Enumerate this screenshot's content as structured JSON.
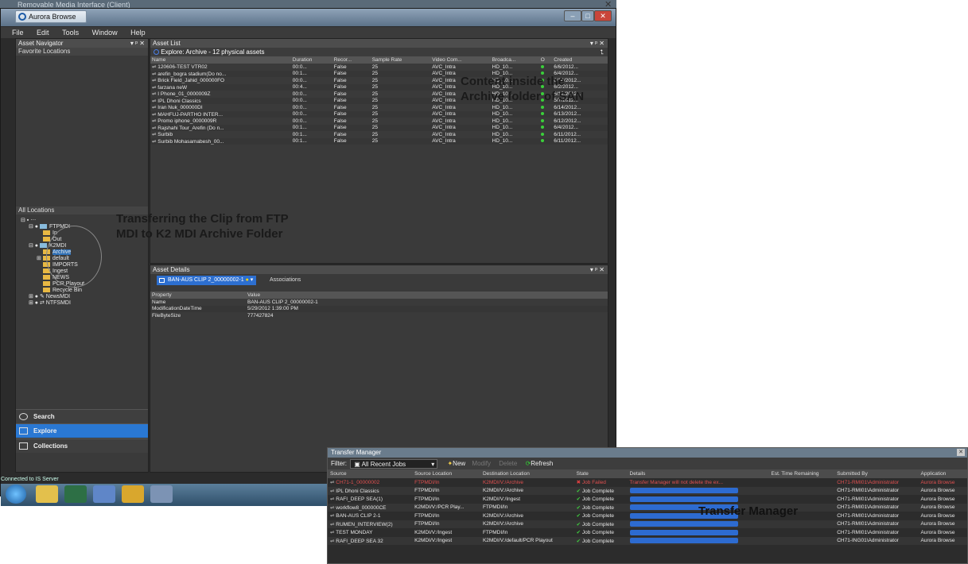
{
  "outer_title": "Removable Media Interface (Client)",
  "app_tab": "Aurora Browse",
  "menu": [
    "File",
    "Edit",
    "Tools",
    "Window",
    "Help"
  ],
  "asset_navigator": {
    "title": "Asset Navigator",
    "favorites": "Favorite Locations",
    "all_locations": "All Locations"
  },
  "tree": [
    "FTPMDI",
    "In",
    "Out",
    "K2MDI",
    "Archive",
    "default",
    "IMPORTS",
    "Ingest",
    "NEWS",
    "PCR Playout",
    "Recycle Bin",
    "NewsMDI",
    "NTFSMDI"
  ],
  "nav_buttons": {
    "search": "Search",
    "explore": "Explore",
    "collections": "Collections"
  },
  "asset_list": {
    "title": "Asset List",
    "explore_label": "Explore: Archive - 12 physical assets",
    "columns": [
      "Name",
      "Duration",
      "Recor...",
      "Sample Rate",
      "Video Com...",
      "Broadca...",
      "O",
      "Created"
    ],
    "rows": [
      [
        "120606-TEST VTR02",
        "00:0...",
        "False",
        "25",
        "AVC_Intra",
        "HD_10...",
        "6/6/2012..."
      ],
      [
        "arefin_bogra stadium(Do no...",
        "00:1...",
        "False",
        "25",
        "AVC_Intra",
        "HD_10...",
        "6/4/2012..."
      ],
      [
        "Brick Field_Jahid_000000FO",
        "00:0...",
        "False",
        "25",
        "AVC_Intra",
        "HD_10...",
        "6/14/2012..."
      ],
      [
        "farzana neW",
        "00:4...",
        "False",
        "25",
        "AVC_Intra",
        "HD_10...",
        "6/2/2012..."
      ],
      [
        "I Phone_01_0000009Z",
        "00:0...",
        "False",
        "25",
        "AVC_Intra",
        "HD_10...",
        "6/12/2012..."
      ],
      [
        "IPL Dhoni Classics",
        "00:0...",
        "False",
        "25",
        "AVC_Intra",
        "HD_10...",
        "5/7/2012..."
      ],
      [
        "Iran Nuk_000000DI",
        "00:0...",
        "False",
        "25",
        "AVC_Intra",
        "HD_10...",
        "6/14/2012..."
      ],
      [
        "MAHFUJ-PARTHO INTER...",
        "00:0...",
        "False",
        "25",
        "AVC_Intra",
        "HD_10...",
        "6/13/2012..."
      ],
      [
        "Promo iphone_0000009R",
        "00:0...",
        "False",
        "25",
        "AVC_Intra",
        "HD_10...",
        "6/12/2012..."
      ],
      [
        "Rajshahi Tour_Arefin (Do n...",
        "00:1...",
        "False",
        "25",
        "AVC_Intra",
        "HD_10...",
        "6/4/2012..."
      ],
      [
        "Surbib",
        "00:1...",
        "False",
        "25",
        "AVC_Intra",
        "HD_10...",
        "6/11/2012..."
      ],
      [
        "Surbib Mohasamabesh_00...",
        "00:1...",
        "False",
        "25",
        "AVC_Intra",
        "HD_10...",
        "6/11/2012..."
      ]
    ]
  },
  "asset_details": {
    "title": "Asset Details",
    "selected_tab": "BAN-AUS CLIP 2_00000002-1",
    "associations": "Associations",
    "columns": [
      "Property",
      "Value"
    ],
    "rows": [
      [
        "Name",
        "BAN-AUS CLIP 2_00000002-1"
      ],
      [
        "ModificationDateTime",
        "5/29/2012 1:39:00 PM"
      ],
      [
        "FileByteSize",
        "777427824"
      ]
    ]
  },
  "status": "Connected to IS Server",
  "annotations": {
    "content": "Content inside the Archive folder of  SAN",
    "transferring": "Transferring the Clip from FTP MDI to K2 MDI Archive Folder",
    "tm": "Transfer  Manager"
  },
  "transfer_manager": {
    "title": "Transfer Manager",
    "filter_label": "Filter:",
    "filter_value": "All Recent Jobs",
    "new": "New",
    "modify": "Modify",
    "delete": "Delete",
    "refresh": "Refresh",
    "columns": [
      "Source",
      "Source Location",
      "Destination Location",
      "State",
      "Details",
      "Est. Time Remaining",
      "Submitted By",
      "Application"
    ],
    "rows": [
      [
        "CH71-1_00000002",
        "FTPMDI/In",
        "K2MDI/V:/Archive",
        "Job Failed",
        "Transfer Manager will not delete the ex...",
        "",
        "CH71-RMI01\\Administrator",
        "Aurora Browse"
      ],
      [
        "IPL Dhoni Classics",
        "FTPMDI/In",
        "K2MDI/V:/Archive",
        "Job Complete",
        "",
        "",
        "CH71-RMI01\\Administrator",
        "Aurora Browse"
      ],
      [
        "RAFI_DEEP SEA(1)",
        "FTPMDI/In",
        "K2MDI/V:/Ingest",
        "Job Complete",
        "",
        "",
        "CH71-RMI01\\Administrator",
        "Aurora Browse"
      ],
      [
        "workflow8_000000CE",
        "K2MDI/V:/PCR Play...",
        "FTPMDI/In",
        "Job Complete",
        "",
        "",
        "CH71-RMI01\\Administrator",
        "Aurora Browse"
      ],
      [
        "BAN-AUS CLIP 2-1",
        "FTPMDI/In",
        "K2MDI/V:/Archive",
        "Job Complete",
        "",
        "",
        "CH71-RMI01\\Administrator",
        "Aurora Browse"
      ],
      [
        "RUMEN_INTERVIEW(2)",
        "FTPMDI/In",
        "K2MDI/V:/Archive",
        "Job Complete",
        "",
        "",
        "CH71-RMI01\\Administrator",
        "Aurora Browse"
      ],
      [
        "TEST MONDAY",
        "K2MDI/V:/Ingest",
        "FTPMDI/In",
        "Job Complete",
        "",
        "",
        "CH71-RMI01\\Administrator",
        "Aurora Browse"
      ],
      [
        "RAFI_DEEP SEA 32",
        "K2MDI/V:/Ingest",
        "K2MDI/V:/default/PCR Playout",
        "Job Complete",
        "",
        "",
        "CH71-ING01\\Administrator",
        "Aurora Browse"
      ]
    ]
  }
}
